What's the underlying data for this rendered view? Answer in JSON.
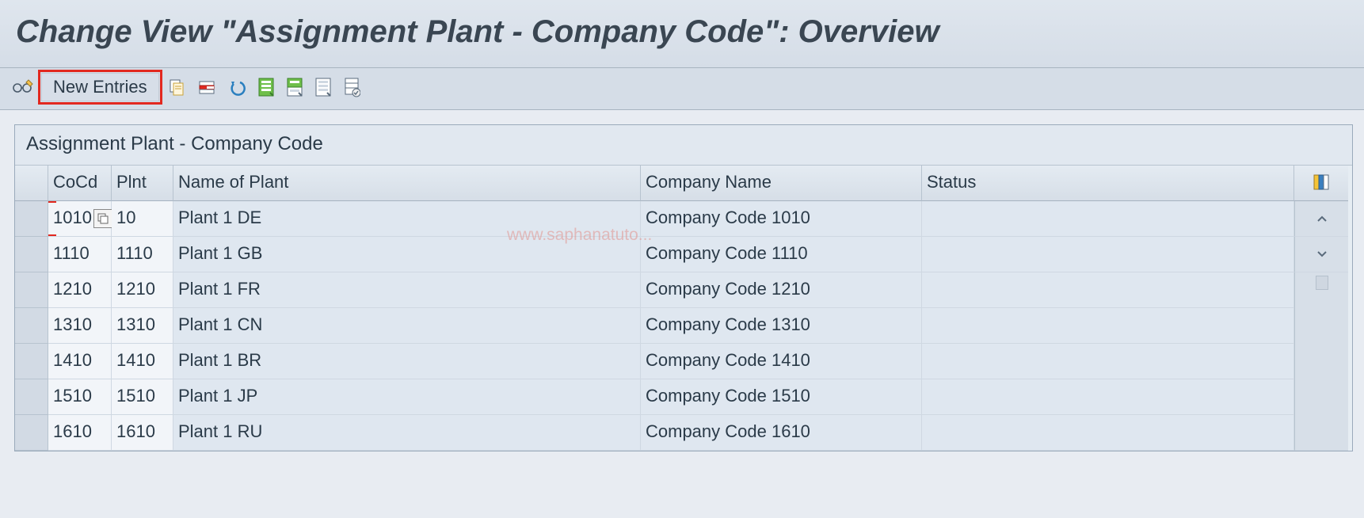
{
  "header": {
    "title": "Change View \"Assignment Plant - Company Code\": Overview"
  },
  "toolbar": {
    "glasses_label": "Display/Change",
    "new_entries_label": "New Entries",
    "copy_label": "Copy As",
    "delete_label": "Delete",
    "undo_label": "Undo",
    "selectall_label": "Select All",
    "selectblock_label": "Select Block",
    "deselect_label": "Deselect All",
    "print_label": "Print"
  },
  "table": {
    "title": "Assignment Plant - Company Code",
    "columns": {
      "cocd": "CoCd",
      "plnt": "Plnt",
      "plant_name": "Name of Plant",
      "company_name": "Company Name",
      "status": "Status"
    },
    "rows": [
      {
        "cocd": "1010",
        "plnt": "10",
        "plant_name": "Plant 1 DE",
        "company_name": "Company Code 1010",
        "status": ""
      },
      {
        "cocd": "1110",
        "plnt": "1110",
        "plant_name": "Plant 1 GB",
        "company_name": "Company Code 1110",
        "status": ""
      },
      {
        "cocd": "1210",
        "plnt": "1210",
        "plant_name": "Plant 1 FR",
        "company_name": "Company Code 1210",
        "status": ""
      },
      {
        "cocd": "1310",
        "plnt": "1310",
        "plant_name": "Plant 1 CN",
        "company_name": "Company Code 1310",
        "status": ""
      },
      {
        "cocd": "1410",
        "plnt": "1410",
        "plant_name": "Plant 1 BR",
        "company_name": "Company Code 1410",
        "status": ""
      },
      {
        "cocd": "1510",
        "plnt": "1510",
        "plant_name": "Plant 1 JP",
        "company_name": "Company Code 1510",
        "status": ""
      },
      {
        "cocd": "1610",
        "plnt": "1610",
        "plant_name": "Plant 1 RU",
        "company_name": "Company Code 1610",
        "status": ""
      }
    ]
  },
  "watermark": "www.saphanatuto..."
}
